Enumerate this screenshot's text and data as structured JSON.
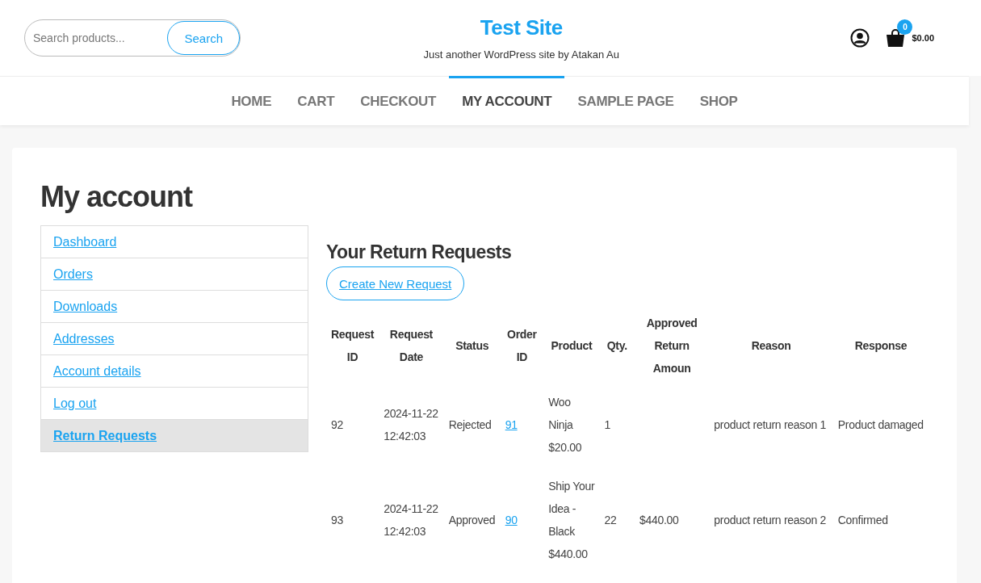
{
  "header": {
    "search": {
      "placeholder": "Search products...",
      "button": "Search"
    },
    "site_title": "Test Site",
    "tagline": "Just another WordPress site by Atakan Au",
    "cart": {
      "count": "0",
      "total": "$0.00"
    }
  },
  "nav": [
    {
      "label": "HOME",
      "selected": false
    },
    {
      "label": "CART",
      "selected": false
    },
    {
      "label": "CHECKOUT",
      "selected": false
    },
    {
      "label": "MY ACCOUNT",
      "selected": true
    },
    {
      "label": "SAMPLE PAGE",
      "selected": false
    },
    {
      "label": "SHOP",
      "selected": false
    }
  ],
  "page_title": "My account",
  "account_menu": [
    {
      "label": "Dashboard",
      "selected": false
    },
    {
      "label": "Orders",
      "selected": false
    },
    {
      "label": "Downloads",
      "selected": false
    },
    {
      "label": "Addresses",
      "selected": false
    },
    {
      "label": "Account details",
      "selected": false
    },
    {
      "label": "Log out",
      "selected": false
    },
    {
      "label": "Return Requests",
      "selected": true
    }
  ],
  "returns": {
    "title": "Your Return Requests",
    "create_button": "Create New Request",
    "table": {
      "columns": [
        "Request ID",
        "Request Date",
        "Status",
        "Order ID",
        "Product",
        "Qty.",
        "Approved Return Amoun",
        "Reason",
        "Response"
      ],
      "rows": [
        {
          "request_id": "92",
          "date": "2024-11-22 12:42:03",
          "status": "Rejected",
          "order_id": "91",
          "product": "Woo Ninja",
          "price": "$20.00",
          "qty": "1",
          "amount": "",
          "reason": "product return reason 1",
          "response": "Product damaged"
        },
        {
          "request_id": "93",
          "date": "2024-11-22 12:42:03",
          "status": "Approved",
          "order_id": "90",
          "product": "Ship Your Idea - Black",
          "price": "$440.00",
          "qty": "22",
          "amount": "$440.00",
          "reason": "product return reason 2",
          "response": "Confirmed"
        }
      ]
    }
  }
}
